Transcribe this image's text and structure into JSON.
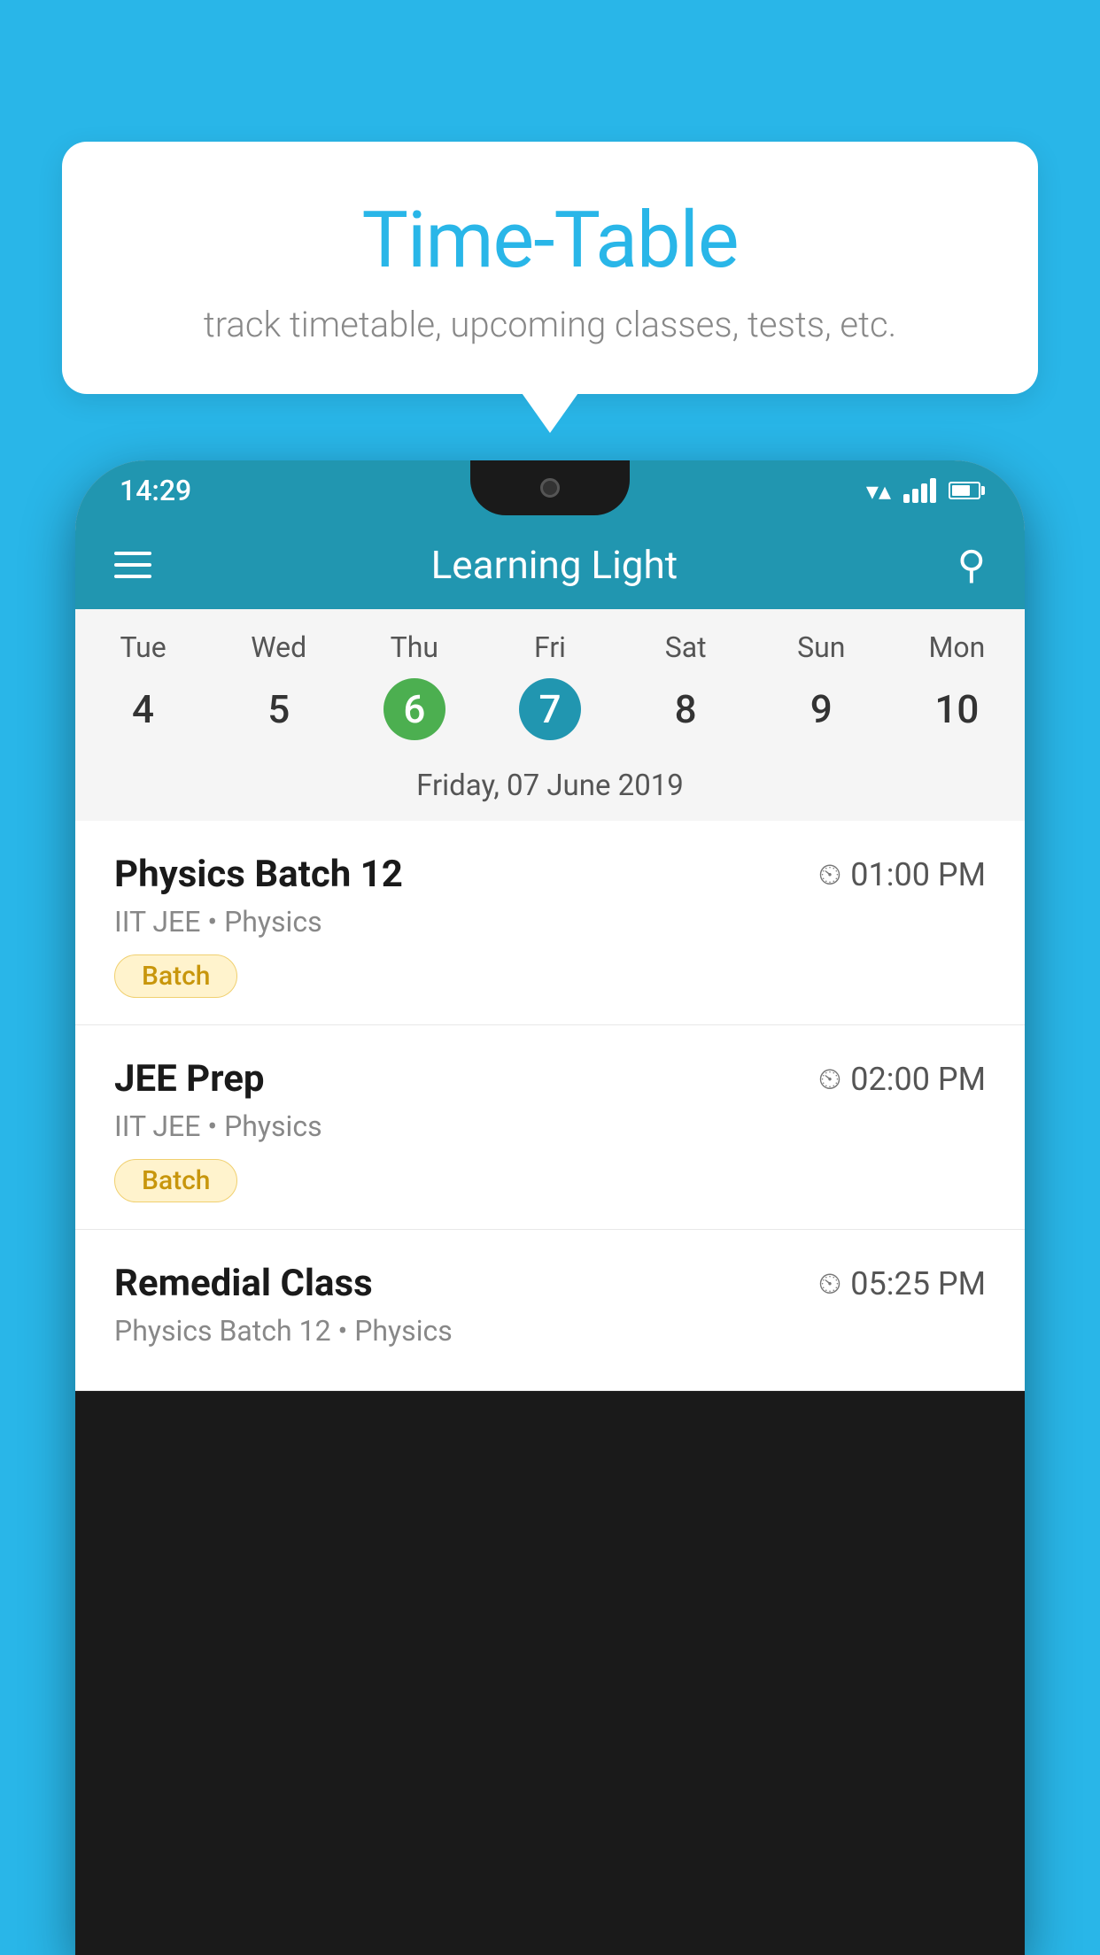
{
  "background_color": "#29b6e8",
  "speech_bubble": {
    "title": "Time-Table",
    "subtitle": "track timetable, upcoming classes, tests, etc."
  },
  "phone": {
    "status_bar": {
      "time": "14:29"
    },
    "app_header": {
      "title": "Learning Light"
    },
    "calendar": {
      "days": [
        {
          "label": "Tue",
          "number": "4"
        },
        {
          "label": "Wed",
          "number": "5"
        },
        {
          "label": "Thu",
          "number": "6",
          "state": "today"
        },
        {
          "label": "Fri",
          "number": "7",
          "state": "selected"
        },
        {
          "label": "Sat",
          "number": "8"
        },
        {
          "label": "Sun",
          "number": "9"
        },
        {
          "label": "Mon",
          "number": "10"
        }
      ],
      "selected_date": "Friday, 07 June 2019"
    },
    "classes": [
      {
        "name": "Physics Batch 12",
        "time": "01:00 PM",
        "detail": "IIT JEE • Physics",
        "badge": "Batch"
      },
      {
        "name": "JEE Prep",
        "time": "02:00 PM",
        "detail": "IIT JEE • Physics",
        "badge": "Batch"
      },
      {
        "name": "Remedial Class",
        "time": "05:25 PM",
        "detail": "Physics Batch 12 • Physics",
        "badge": null
      }
    ]
  }
}
